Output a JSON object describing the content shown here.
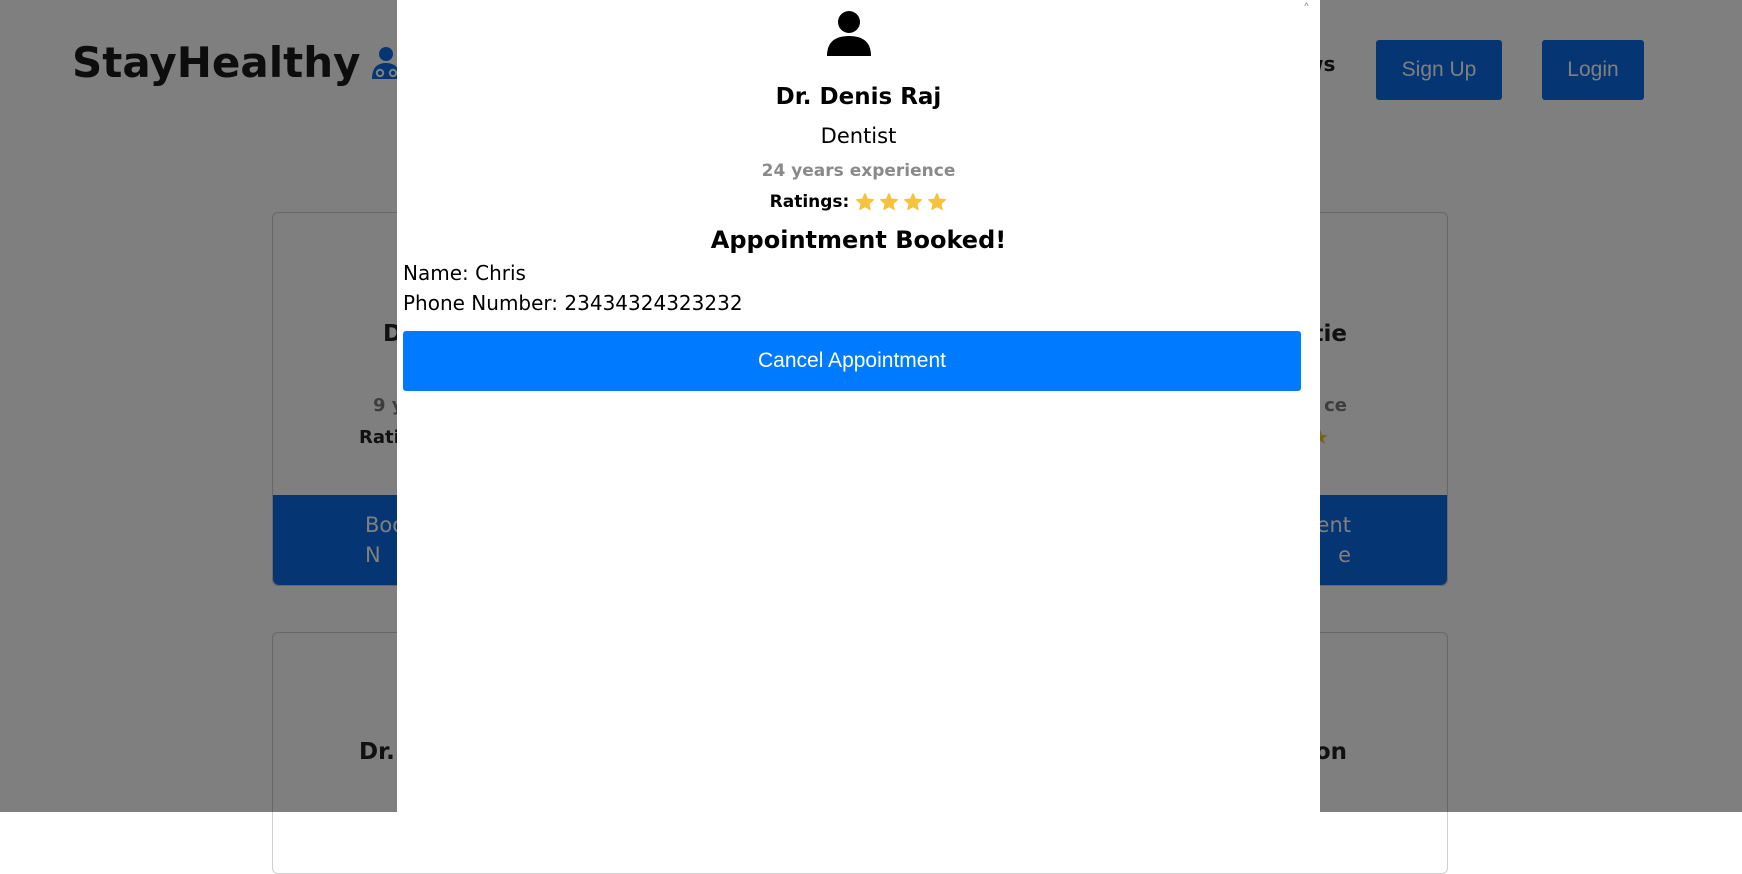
{
  "navbar": {
    "brand": "StayHealthy",
    "brand_dot": ".",
    "partial_link": "ws",
    "signup_label": "Sign Up",
    "login_label": "Login"
  },
  "cards": {
    "row1": {
      "left_name": "D",
      "right_name": "tie",
      "left_exp": "9 y",
      "right_exp": "ce",
      "left_ratings": "Rati",
      "right_star": "★",
      "left_btn": "Boo\nN",
      "right_btn": "ent\ne"
    },
    "row2": {
      "left_name": "Dr.",
      "right_name": "rson"
    }
  },
  "modal": {
    "close_glyph": "˄",
    "doctor_name": "Dr. Denis Raj",
    "specialty": "Dentist",
    "experience": "24 years experience",
    "ratings_label": "Ratings:",
    "rating_stars": 4,
    "booked_title": "Appointment Booked!",
    "name_line": "Name: Chris",
    "phone_line": "Phone Number: 23434324323232",
    "cancel_label": "Cancel Appointment"
  },
  "colors": {
    "primary": "#0a6ae6",
    "cancel_button": "#007bff",
    "star": "#f6c33c",
    "overlay": "rgba(0,0,0,0.5)"
  }
}
